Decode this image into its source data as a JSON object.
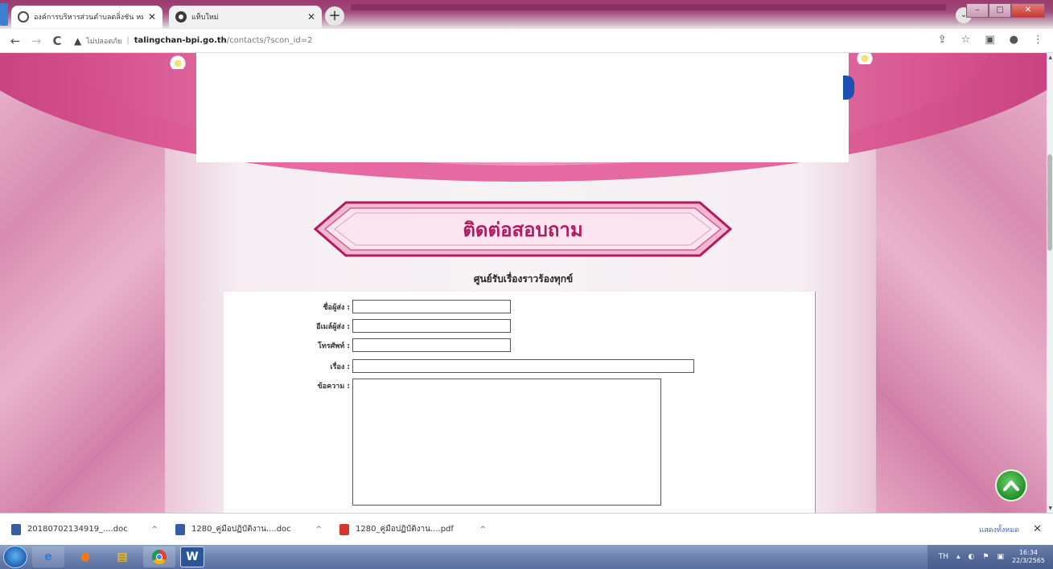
{
  "browser": {
    "tabs": [
      {
        "title": "องค์การบริหารส่วนตำบลตลิ่งชัน หมู่ที่",
        "active": true
      },
      {
        "title": "แท็บใหม่",
        "active": false
      }
    ],
    "security_label": "ไม่ปลอดภัย",
    "url_host": "talingchan-bpi.go.th",
    "url_path": "/contacts/?scon_id=2"
  },
  "page": {
    "section_title": "ติดต่อสอบถาม",
    "form_heading": "ศูนย์รับเรื่องราวร้องทุกข์",
    "form": {
      "sender_name_label": "ชื่อผู้ส่ง :",
      "sender_name_value": "",
      "sender_email_label": "อีเมล์ผู้ส่ง :",
      "sender_email_value": "",
      "phone_label": "โทรศัพท์ :",
      "phone_value": "",
      "subject_label": "เรื่อง :",
      "subject_value": "",
      "message_label": "ข้อความ :",
      "message_value": ""
    }
  },
  "downloads": {
    "items": [
      {
        "name": "20180702134919_....doc",
        "type": "doc"
      },
      {
        "name": "1280_คู่มือปฏิบัติงาน....doc",
        "type": "doc"
      },
      {
        "name": "1280_คู่มือปฏิบัติงาน....pdf",
        "type": "pdf"
      }
    ],
    "show_all": "แสดงทั้งหมด"
  },
  "taskbar": {
    "language": "TH",
    "time": "16:34",
    "date": "22/3/2565"
  },
  "colors": {
    "accent_pink": "#b3195f",
    "scroll_top_green": "#1f8f2a"
  }
}
